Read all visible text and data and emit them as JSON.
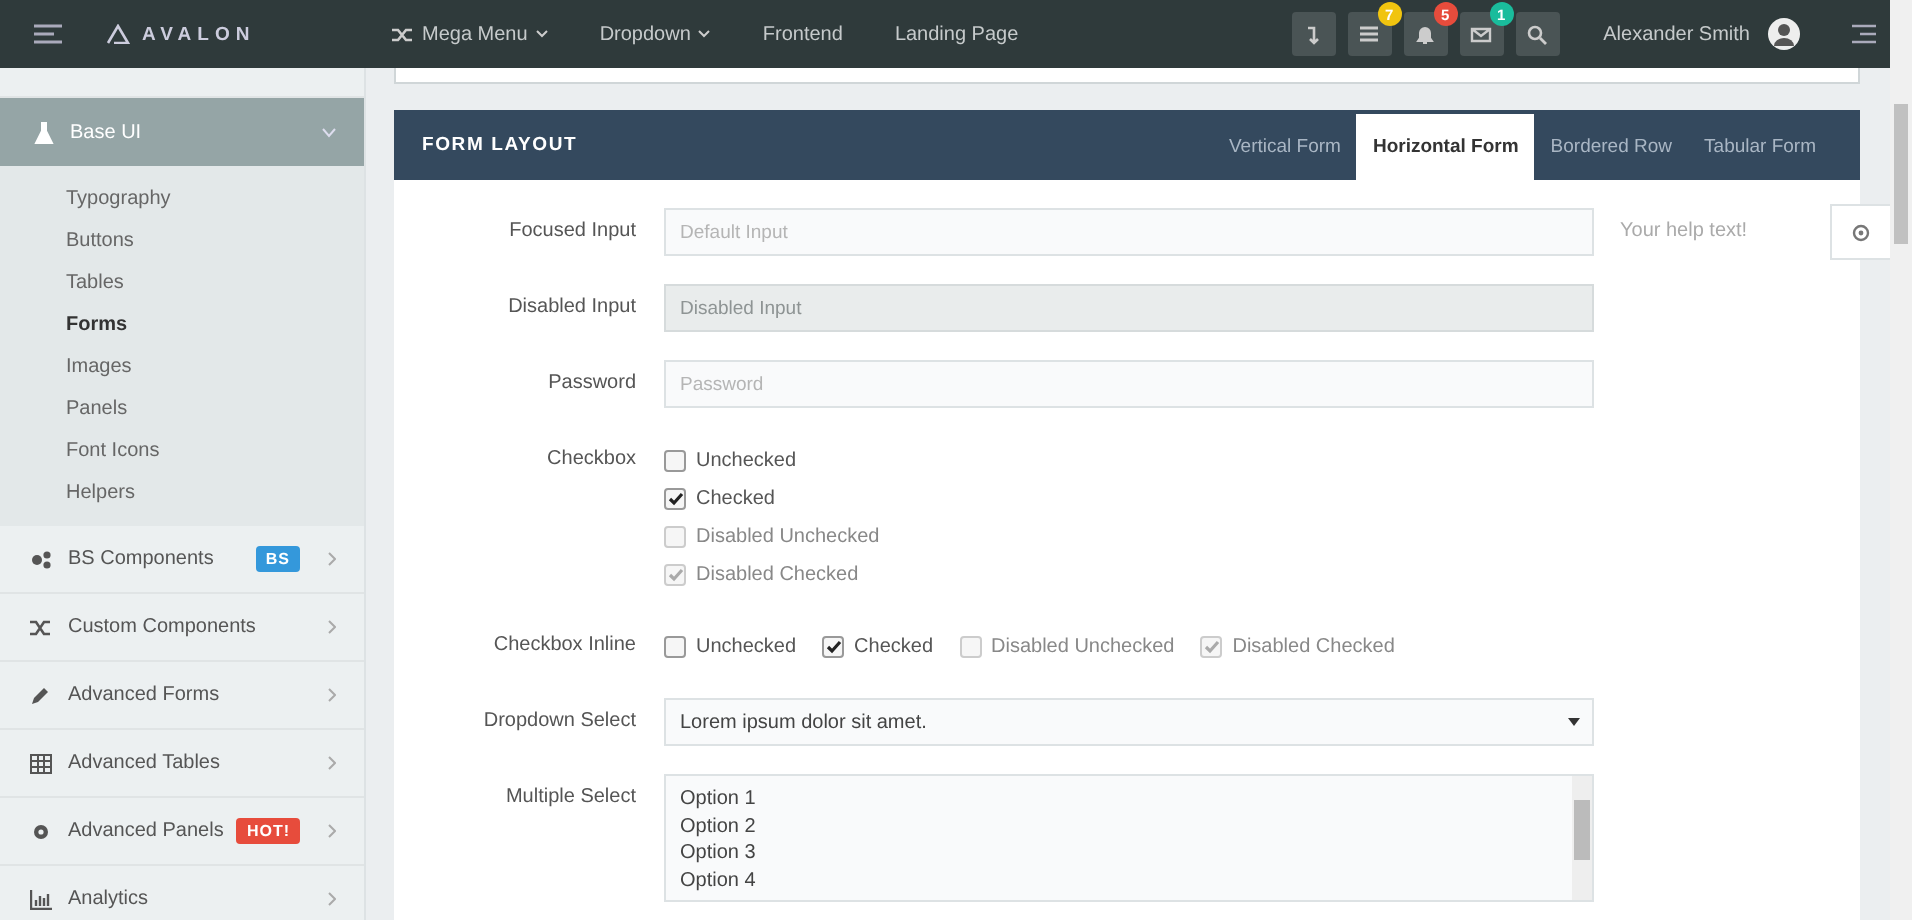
{
  "topbar": {
    "brand": "AVALON",
    "nav": [
      {
        "label": "Mega Menu"
      },
      {
        "label": "Dropdown"
      },
      {
        "label": "Frontend"
      },
      {
        "label": "Landing Page"
      }
    ],
    "notifications": [
      {
        "badge": "7",
        "color": "#f1c40f"
      },
      {
        "badge": "5",
        "color": "#e74c3c"
      },
      {
        "badge": "1",
        "color": "#1abc9c"
      }
    ],
    "user": "Alexander Smith"
  },
  "sidebar": {
    "section": {
      "label": "Base UI",
      "expanded": true,
      "children": [
        {
          "label": "Typography",
          "selected": false
        },
        {
          "label": "Buttons",
          "selected": false
        },
        {
          "label": "Tables",
          "selected": false
        },
        {
          "label": "Forms",
          "selected": true
        },
        {
          "label": "Images",
          "selected": false
        },
        {
          "label": "Panels",
          "selected": false
        },
        {
          "label": "Font Icons",
          "selected": false
        },
        {
          "label": "Helpers",
          "selected": false
        }
      ]
    },
    "items": [
      {
        "label": "BS Components",
        "badge": "BS",
        "color": "#3498db"
      },
      {
        "label": "Custom Components"
      },
      {
        "label": "Advanced Forms"
      },
      {
        "label": "Advanced Tables"
      },
      {
        "label": "Advanced Panels",
        "badge": "HOT!",
        "color": "#e74c3c"
      },
      {
        "label": "Analytics"
      }
    ]
  },
  "panel": {
    "title": "FORM LAYOUT",
    "tabs": [
      {
        "label": "Vertical Form",
        "selected": false
      },
      {
        "label": "Horizontal Form",
        "selected": true
      },
      {
        "label": "Bordered Row",
        "selected": false
      },
      {
        "label": "Tabular Form",
        "selected": false
      }
    ],
    "rows": [
      {
        "kind": "input",
        "label": "Focused Input",
        "placeholder": "Default Input",
        "disabled": false,
        "help": "Your help text!"
      },
      {
        "kind": "input",
        "label": "Disabled Input",
        "placeholder": "Disabled Input",
        "disabled": true
      },
      {
        "kind": "input",
        "label": "Password",
        "placeholder": "Password",
        "disabled": false
      },
      {
        "kind": "checks",
        "label": "Checkbox",
        "inline": false,
        "options": [
          {
            "label": "Unchecked",
            "checked": false,
            "disabled": false
          },
          {
            "label": "Checked",
            "checked": true,
            "disabled": false
          },
          {
            "label": "Disabled Unchecked",
            "checked": false,
            "disabled": true
          },
          {
            "label": "Disabled Checked",
            "checked": true,
            "disabled": true
          }
        ]
      },
      {
        "kind": "checks",
        "label": "Checkbox Inline",
        "inline": true,
        "options": [
          {
            "label": "Unchecked",
            "checked": false,
            "disabled": false
          },
          {
            "label": "Checked",
            "checked": true,
            "disabled": false
          },
          {
            "label": "Disabled Unchecked",
            "checked": false,
            "disabled": true
          },
          {
            "label": "Disabled Checked",
            "checked": true,
            "disabled": true
          }
        ]
      },
      {
        "kind": "select",
        "label": "Dropdown Select",
        "value": "Lorem ipsum dolor sit amet."
      },
      {
        "kind": "multi",
        "label": "Multiple Select",
        "options": [
          "Option 1",
          "Option 2",
          "Option 3",
          "Option 4"
        ]
      }
    ]
  }
}
